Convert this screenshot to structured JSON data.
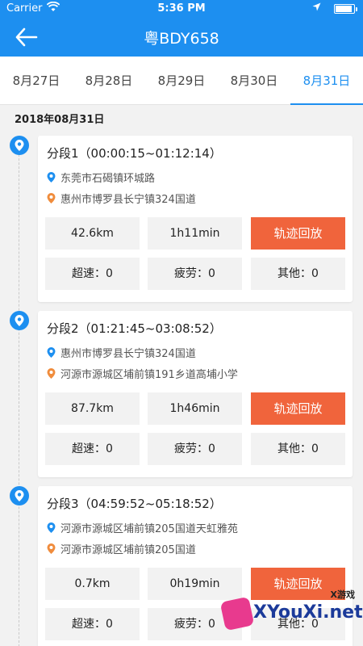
{
  "status_bar": {
    "carrier": "Carrier",
    "time": "5:36 PM"
  },
  "nav": {
    "title": "粤BDY658"
  },
  "tabs": [
    {
      "label": "8月27日",
      "active": false
    },
    {
      "label": "8月28日",
      "active": false
    },
    {
      "label": "8月29日",
      "active": false
    },
    {
      "label": "8月30日",
      "active": false
    },
    {
      "label": "8月31日",
      "active": true
    }
  ],
  "date_header": "2018年08月31日",
  "segments": [
    {
      "title": "分段1（00:00:15~01:12:14）",
      "start": "东莞市石碣镇环城路",
      "end": "惠州市博罗县长宁镇324国道",
      "distance": "42.6km",
      "duration": "1h11min",
      "replay": "轨迹回放",
      "overspeed": "超速：0",
      "fatigue": "疲劳：0",
      "other": "其他：0"
    },
    {
      "title": "分段2（01:21:45~03:08:52）",
      "start": "惠州市博罗县长宁镇324国道",
      "end": "河源市源城区埔前镇191乡道高埔小学",
      "distance": "87.7km",
      "duration": "1h46min",
      "replay": "轨迹回放",
      "overspeed": "超速：0",
      "fatigue": "疲劳：0",
      "other": "其他：0"
    },
    {
      "title": "分段3（04:59:52~05:18:52）",
      "start": "河源市源城区埔前镇205国道天虹雅苑",
      "end": "河源市源城区埔前镇205国道",
      "distance": "0.7km",
      "duration": "0h19min",
      "replay": "轨迹回放",
      "overspeed": "超速：0",
      "fatigue": "疲劳：0",
      "other": "其他：0"
    }
  ],
  "watermark": {
    "sub": "X游戏",
    "brand": "XYouXi.net"
  },
  "colors": {
    "primary": "#1d8ff0",
    "replay": "#f0643c",
    "start_pin": "#1d8ff0",
    "end_pin": "#f08c3c"
  }
}
